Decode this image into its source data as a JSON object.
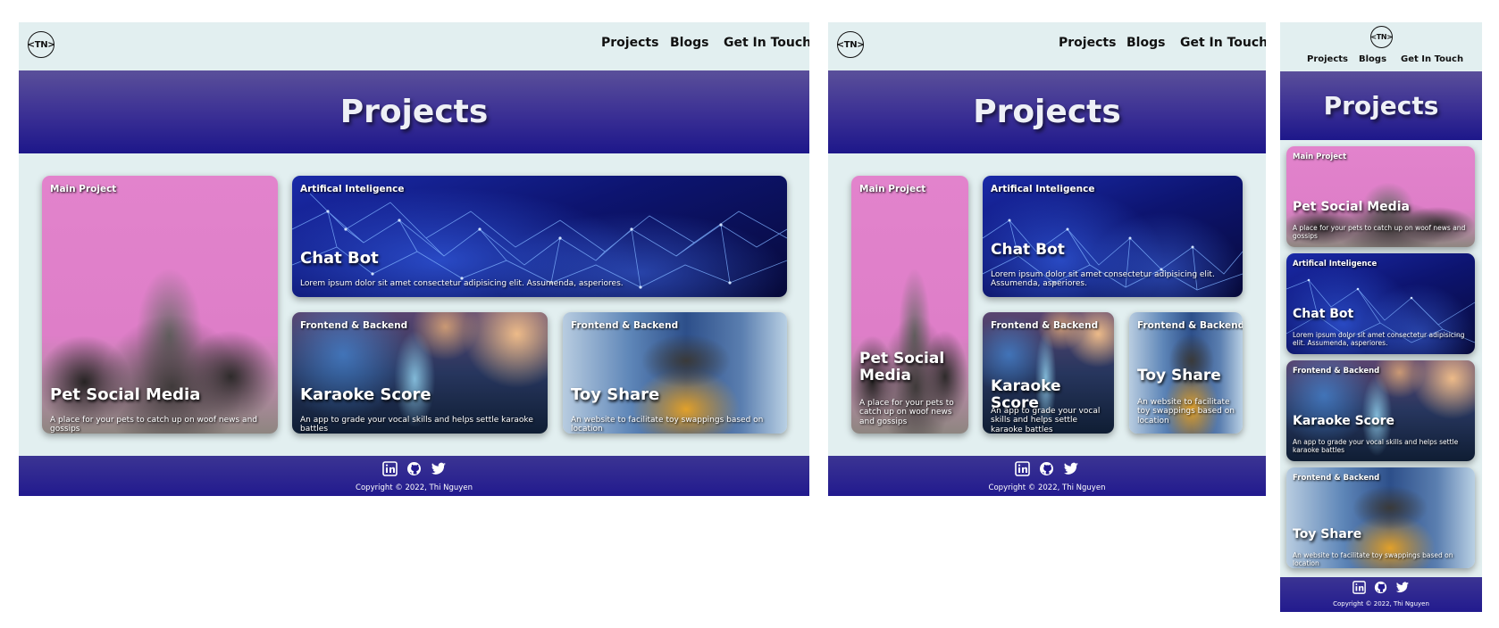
{
  "brand": {
    "logo_text": "<TN>"
  },
  "nav": {
    "items": [
      "Projects",
      "Blogs",
      "Get In Touch"
    ]
  },
  "hero": {
    "title": "Projects"
  },
  "cards": [
    {
      "tag": "Main Project",
      "title": "Pet Social Media",
      "description": "A place for your pets to catch up on woof news and gossips"
    },
    {
      "tag": "Artifical Inteligence",
      "title": "Chat Bot",
      "description": "Lorem ipsum dolor sit amet consectetur adipisicing elit. Assumenda, asperiores."
    },
    {
      "tag": "Frontend & Backend",
      "title": "Karaoke Score",
      "description": "An app to grade your vocal skills and helps settle karaoke battles"
    },
    {
      "tag": "Frontend & Backend",
      "title": "Toy Share",
      "description": "An website to facilitate toy swappings based on location"
    }
  ],
  "footer": {
    "icons": [
      "linkedin-icon",
      "github-icon",
      "twitter-icon"
    ],
    "copyright": "Copyright © 2022, Thi Nguyen"
  },
  "colors": {
    "page_bg": "#e2eff0",
    "hero_top": "#5a4f9a",
    "hero_bottom": "#1d178a",
    "footer": "#221a8e"
  }
}
